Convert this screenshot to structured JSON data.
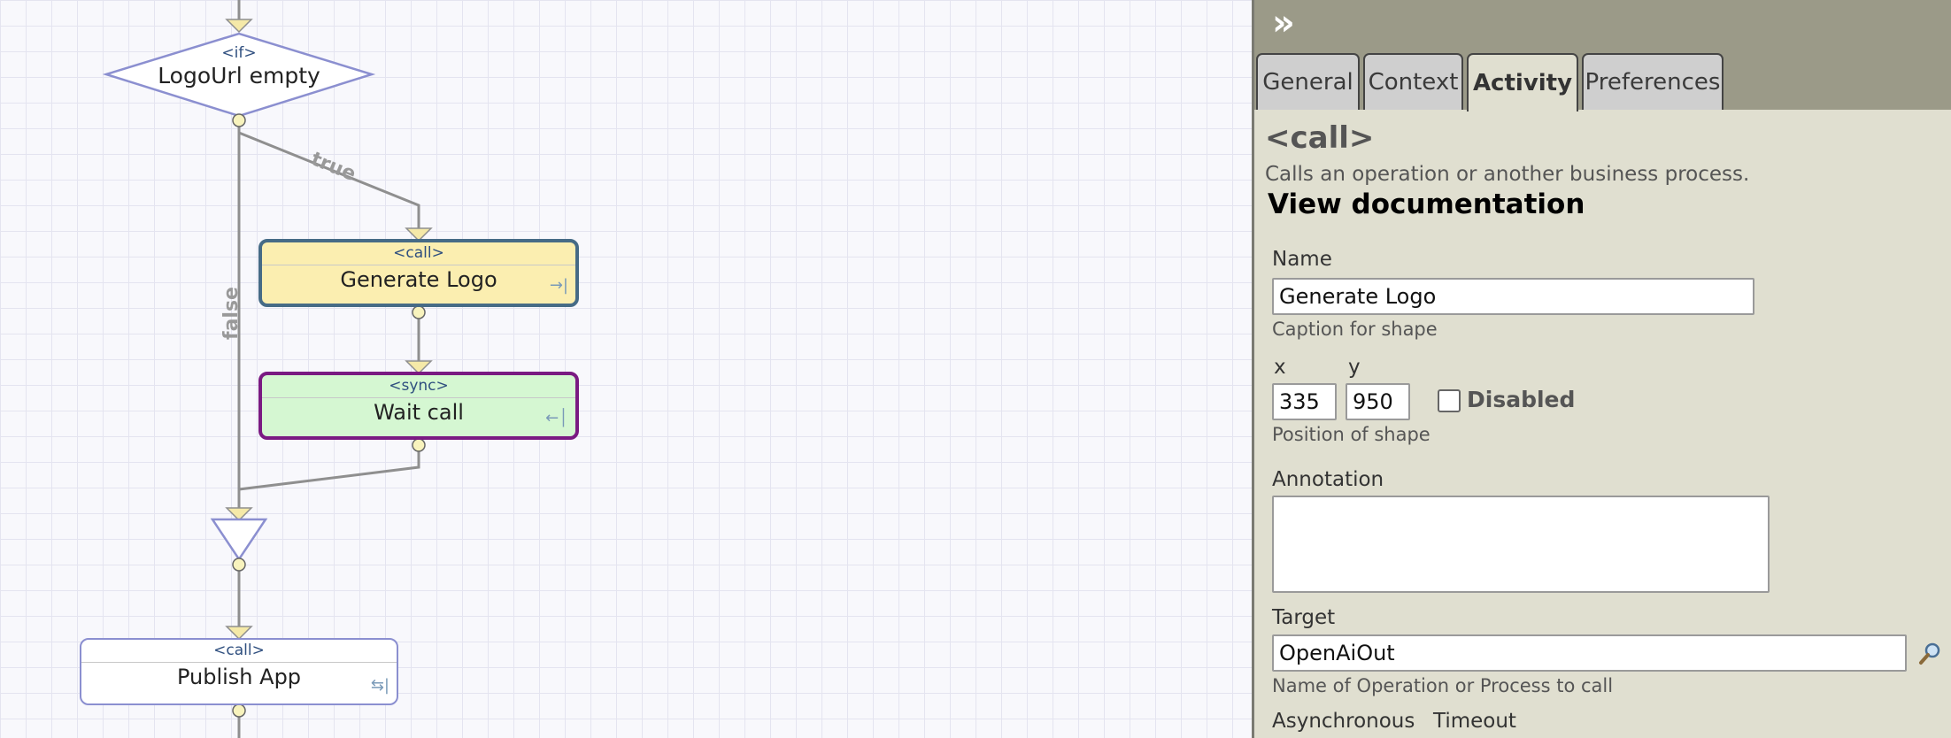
{
  "diagram": {
    "if_node": {
      "type": "<if>",
      "caption": "LogoUrl empty"
    },
    "edge_true_label": "true",
    "edge_false_label": "false",
    "generate_logo": {
      "type": "<call>",
      "caption": "Generate Logo"
    },
    "wait_call": {
      "type": "<sync>",
      "caption": "Wait call"
    },
    "publish_app": {
      "type": "<call>",
      "caption": "Publish App"
    }
  },
  "panel": {
    "collapse_glyph": "»",
    "tabs": [
      "General",
      "Context",
      "Activity",
      "Preferences"
    ],
    "active_tab": "Activity",
    "activity_title": "<call>",
    "activity_description": "Calls an operation or another business process.",
    "view_doc_label": "View documentation",
    "name_label": "Name",
    "name_value": "Generate Logo",
    "name_hint": "Caption for shape",
    "x_label": "x",
    "x_value": "335",
    "y_label": "y",
    "y_value": "950",
    "disabled_label": "Disabled",
    "disabled_checked": false,
    "position_hint": "Position of shape",
    "annotation_label": "Annotation",
    "annotation_value": "",
    "target_label": "Target",
    "target_value": "OpenAiOut",
    "target_hint": "Name of Operation or Process to call",
    "async_label": "Asynchronous",
    "timeout_label": "Timeout"
  },
  "colors": {
    "call_fill": "#fbeeb0",
    "call_border": "#466b86",
    "sync_fill": "#d5f7d2",
    "sync_border": "#7a1a82",
    "shape_border": "#8b8fd0",
    "panel_bg": "#e0dfd0",
    "panel_header": "#9b9a88"
  },
  "icons": {
    "collapse": "double-chevron-right-icon",
    "search": "magnifier-icon"
  }
}
